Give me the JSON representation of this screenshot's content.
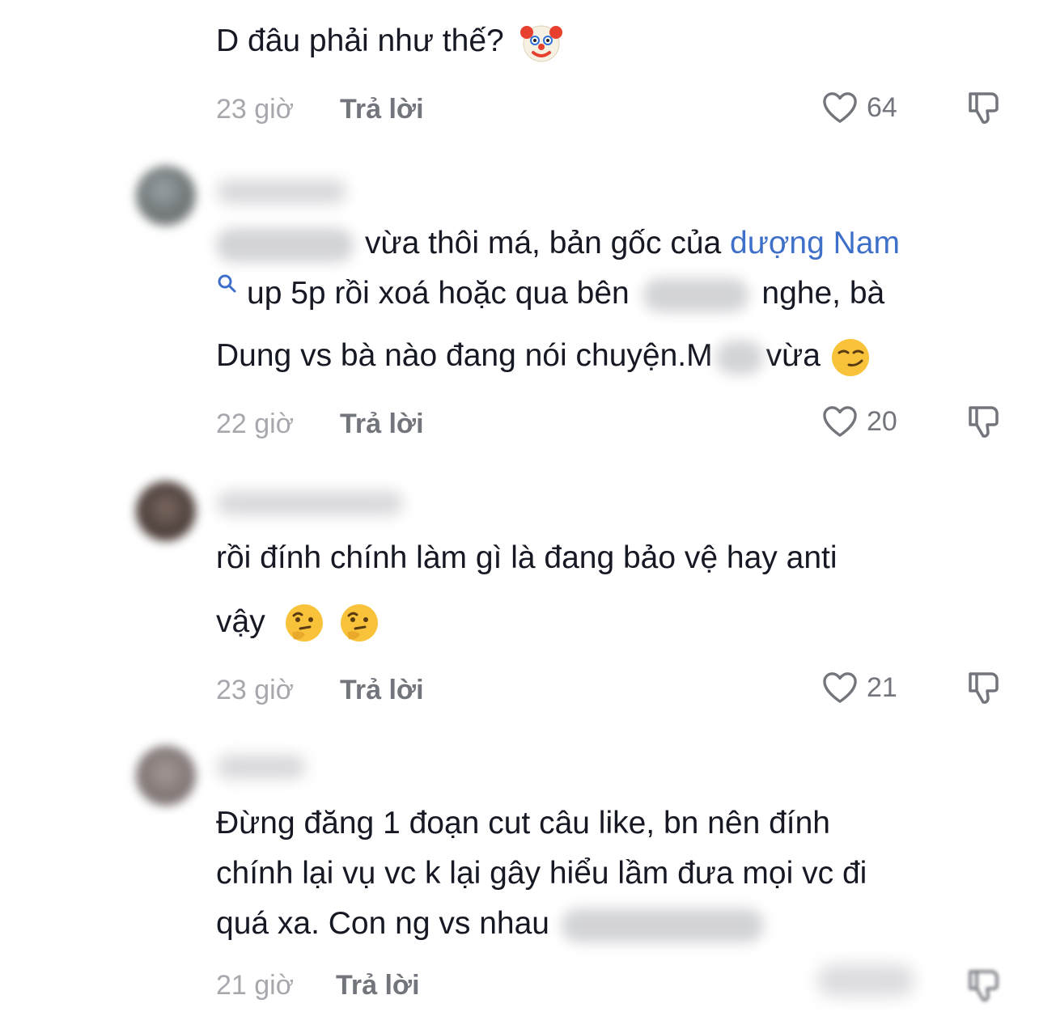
{
  "comments": [
    {
      "lines": [
        "D đâu phải như thế?"
      ],
      "time": "23 giờ",
      "reply": "Trả lời",
      "likes": "64"
    },
    {
      "line1_text": "vừa thôi má, bản gốc của",
      "line1_link": "dượng Nam",
      "line2_a": "up 5p rồi xoá hoặc qua bên",
      "line2_b": "nghe, bà",
      "line3_a": "Dung vs bà nào đang nói chuyện.M",
      "line3_b": "vừa",
      "time": "22 giờ",
      "reply": "Trả lời",
      "likes": "20"
    },
    {
      "lines": [
        "rồi đính chính làm gì là đang bảo vệ hay anti",
        "vậy"
      ],
      "time": "23 giờ",
      "reply": "Trả lời",
      "likes": "21"
    },
    {
      "lines": [
        "Đừng đăng 1 đoạn cut câu like, bn nên đính",
        "chính lại vụ vc k lại gây hiểu lầm đưa mọi vc đi",
        "quá xa. Con ng vs nhau"
      ],
      "time": "21 giờ",
      "reply": "Trả lời"
    }
  ],
  "icons": {
    "like": "heart-outline-icon",
    "dislike": "thumbs-down-icon",
    "search": "search-icon",
    "emoji_clown": "clown-emoji",
    "emoji_smirk": "smirk-emoji",
    "emoji_thinking": "thinking-emoji"
  },
  "colors": {
    "link": "#3e6fc9",
    "muted": "#a7a8ad",
    "text": "#161823"
  }
}
